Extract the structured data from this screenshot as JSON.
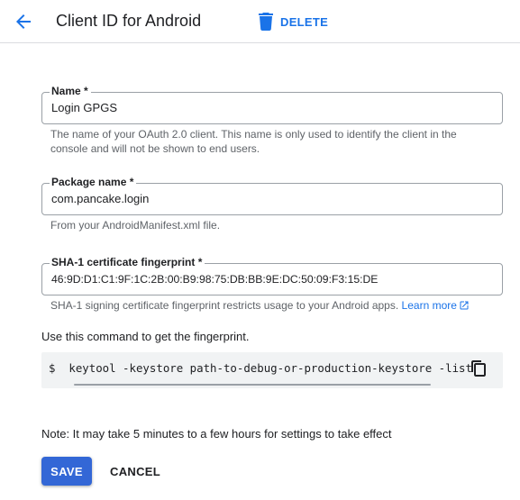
{
  "colors": {
    "accent": "#1a73e8",
    "primary_button": "#3367d6",
    "border": "#9aa0a6",
    "hint_text": "#5f6368",
    "code_bg": "#f1f3f4"
  },
  "header": {
    "back_icon": "arrow-left-icon",
    "title": "Client ID for Android",
    "delete_icon": "trash-icon",
    "delete_label": "DELETE"
  },
  "form": {
    "name": {
      "label": "Name *",
      "value": "Login GPGS",
      "hint": "The name of your OAuth 2.0 client. This name is only used to identify the client in the console and will not be shown to end users."
    },
    "package": {
      "label": "Package name *",
      "value": "com.pancake.login",
      "hint": "From your AndroidManifest.xml file."
    },
    "sha1": {
      "label": "SHA-1 certificate fingerprint *",
      "value": "46:9D:D1:C1:9F:1C:2B:00:B9:98:75:DB:BB:9E:DC:50:09:F3:15:DE",
      "hint": "SHA-1 signing certificate fingerprint restricts usage to your Android apps.",
      "learn_more": "Learn more",
      "learn_more_icon": "open-in-new-icon"
    }
  },
  "command": {
    "heading": "Use this command to get the fingerprint.",
    "code": "$  keytool -keystore path-to-debug-or-production-keystore -list",
    "copy_icon": "copy-icon"
  },
  "note": "Note: It may take 5 minutes to a few hours for settings to take effect",
  "actions": {
    "save": "SAVE",
    "cancel": "CANCEL"
  }
}
